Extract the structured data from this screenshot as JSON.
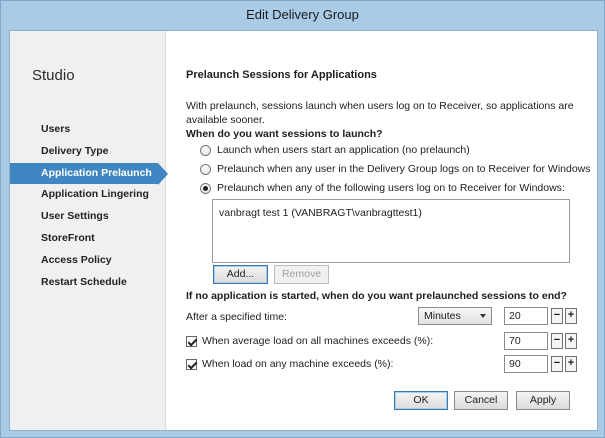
{
  "window": {
    "title": "Edit Delivery Group"
  },
  "sidebar": {
    "heading": "Studio",
    "items": [
      {
        "label": "Users"
      },
      {
        "label": "Delivery Type"
      },
      {
        "label": "Application Prelaunch",
        "active": true
      },
      {
        "label": "Application Lingering"
      },
      {
        "label": "User Settings"
      },
      {
        "label": "StoreFront"
      },
      {
        "label": "Access Policy"
      },
      {
        "label": "Restart Schedule"
      }
    ]
  },
  "main": {
    "section_title": "Prelaunch Sessions for Applications",
    "description": "With prelaunch, sessions launch when users log on to Receiver, so applications are available sooner.",
    "launch_question": "When do you want sessions to launch?",
    "launch_options": [
      {
        "label": "Launch when users start an application (no prelaunch)",
        "checked": false
      },
      {
        "label": "Prelaunch when any user in the Delivery Group logs on to Receiver for Windows",
        "checked": false
      },
      {
        "label": "Prelaunch when any of the following users log on to Receiver for Windows:",
        "checked": true
      }
    ],
    "users": [
      "vanbragt test 1 (VANBRAGT\\vanbragttest1)"
    ],
    "add_button": "Add...",
    "remove_button": "Remove",
    "end_question": "If no application is started, when do you want prelaunched sessions to end?",
    "after_time_label": "After a specified time:",
    "time_unit": "Minutes",
    "time_value": "20",
    "avg_load_label": "When average load on all machines exceeds (%):",
    "avg_load_checked": true,
    "avg_load_value": "70",
    "any_load_label": "When load on any machine exceeds (%):",
    "any_load_checked": true,
    "any_load_value": "90",
    "stepper_minus": "−",
    "stepper_plus": "+"
  },
  "footer": {
    "ok": "OK",
    "cancel": "Cancel",
    "apply": "Apply"
  },
  "colors": {
    "accent": "#3f86c2",
    "titlebar": "#a9cbe6"
  }
}
